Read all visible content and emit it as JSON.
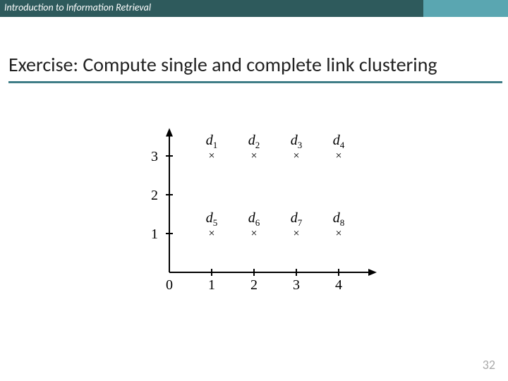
{
  "header": {
    "course": "Introduction to Information Retrieval"
  },
  "title": "Exercise: Compute single and complete link clustering",
  "page_number": "32",
  "chart_data": {
    "type": "scatter",
    "title": "",
    "xlabel": "",
    "ylabel": "",
    "xlim": [
      0,
      5
    ],
    "ylim": [
      0,
      3.5
    ],
    "xticks": [
      0,
      1,
      2,
      3,
      4
    ],
    "yticks": [
      0,
      1,
      2,
      3
    ],
    "points": [
      {
        "name": "d1",
        "x": 1,
        "y": 3
      },
      {
        "name": "d2",
        "x": 2,
        "y": 3
      },
      {
        "name": "d3",
        "x": 3,
        "y": 3
      },
      {
        "name": "d4",
        "x": 4,
        "y": 3
      },
      {
        "name": "d5",
        "x": 1,
        "y": 1
      },
      {
        "name": "d6",
        "x": 2,
        "y": 1
      },
      {
        "name": "d7",
        "x": 3,
        "y": 1
      },
      {
        "name": "d8",
        "x": 4,
        "y": 1
      }
    ]
  }
}
